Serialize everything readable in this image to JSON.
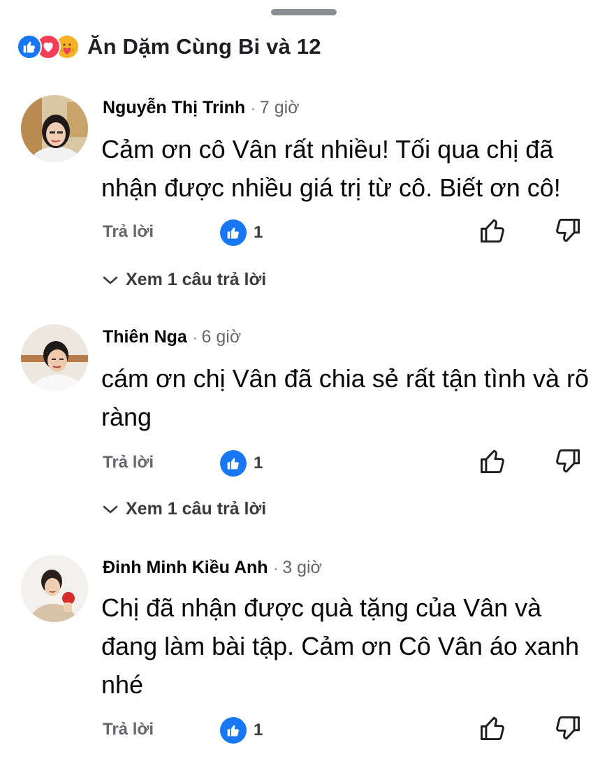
{
  "reactions": {
    "summary": "Ăn Dặm Cùng Bi và 12",
    "types": [
      "like-icon",
      "love-icon",
      "care-icon"
    ]
  },
  "actions": {
    "reply_label": "Trả lời",
    "view_replies_label": "Xem 1 câu trả lời"
  },
  "comments": [
    {
      "author": "Nguyễn Thị Trinh",
      "separator": "·",
      "time": "7 giờ",
      "text": "Cảm ơn cô Vân rất nhiều! Tối qua chị đã nhận được nhiều giá trị từ cô. Biết ơn cô!",
      "likes": "1"
    },
    {
      "author": "Thiên Nga",
      "separator": "·",
      "time": "6 giờ",
      "text": "cám ơn chị Vân đã chia sẻ rất tận tình và rõ ràng",
      "likes": "1"
    },
    {
      "author": "Đinh Minh Kiều Anh",
      "separator": "·",
      "time": "3 giờ",
      "text": "Chị đã nhận được quà tặng của Vân và đang làm bài tập. Cảm ơn Cô Vân áo xanh nhé",
      "likes": "1"
    }
  ],
  "colors": {
    "like_blue": "#1877f2",
    "love_red": "#f33e58",
    "care_yellow": "#f7b125",
    "secondary_text": "#65676b"
  }
}
